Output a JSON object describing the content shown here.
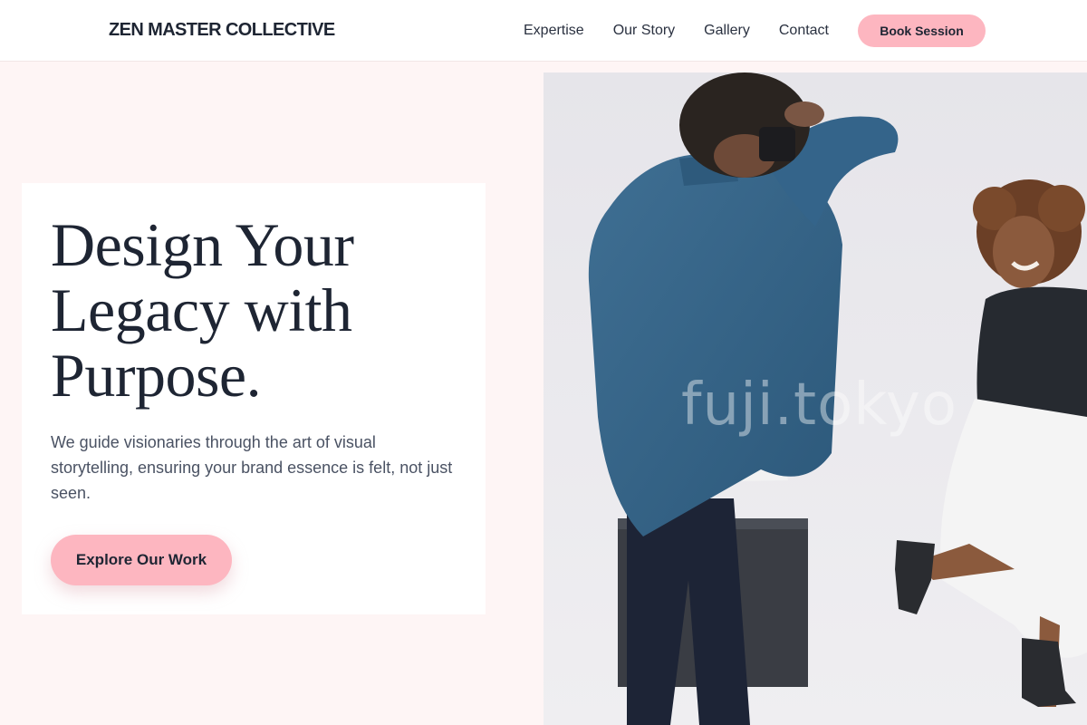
{
  "header": {
    "brand": "ZEN MASTER COLLECTIVE",
    "nav": [
      "Expertise",
      "Our Story",
      "Gallery",
      "Contact"
    ],
    "cta_label": "Book Session"
  },
  "hero": {
    "title_lines": [
      "Design Your",
      "Legacy with",
      "Purpose."
    ],
    "description": "We guide visionaries through the art of visual storytelling, ensuring your brand essence is felt, not just seen.",
    "button_label": "Explore Our Work"
  },
  "photo": {
    "watermark": "fuji.tokyo",
    "subject": "photographer-shooting-model"
  },
  "colors": {
    "accent": "#fdb6c0",
    "page_bg": "#fef5f5",
    "text_dark": "#1e2533"
  }
}
